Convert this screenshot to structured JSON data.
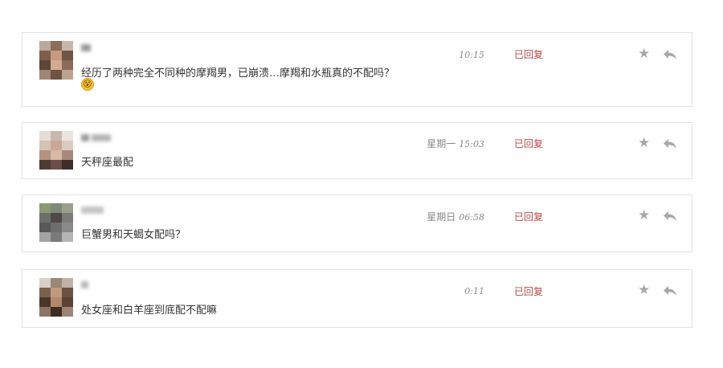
{
  "messages": [
    {
      "time": "10:15",
      "day": "",
      "status": "已回复",
      "text": "经历了两种完全不同种的摩羯男，已崩溃…摩羯和水瓶真的不配吗？",
      "emoji": "😵"
    },
    {
      "time": "15:03",
      "day": "星期一",
      "status": "已回复",
      "text": "天秤座最配"
    },
    {
      "time": "06:58",
      "day": "星期日",
      "status": "已回复",
      "text": "巨蟹男和天蝎女配吗？"
    },
    {
      "time": "0:11",
      "day": "",
      "status": "已回复",
      "text": "处女座和白羊座到底配不配嘛"
    }
  ],
  "icons": {
    "star": "star-icon",
    "reply": "reply-icon"
  },
  "colors": {
    "status": "#b44a4a",
    "border": "#e3e3e3",
    "icon": "#a8a8a8"
  }
}
